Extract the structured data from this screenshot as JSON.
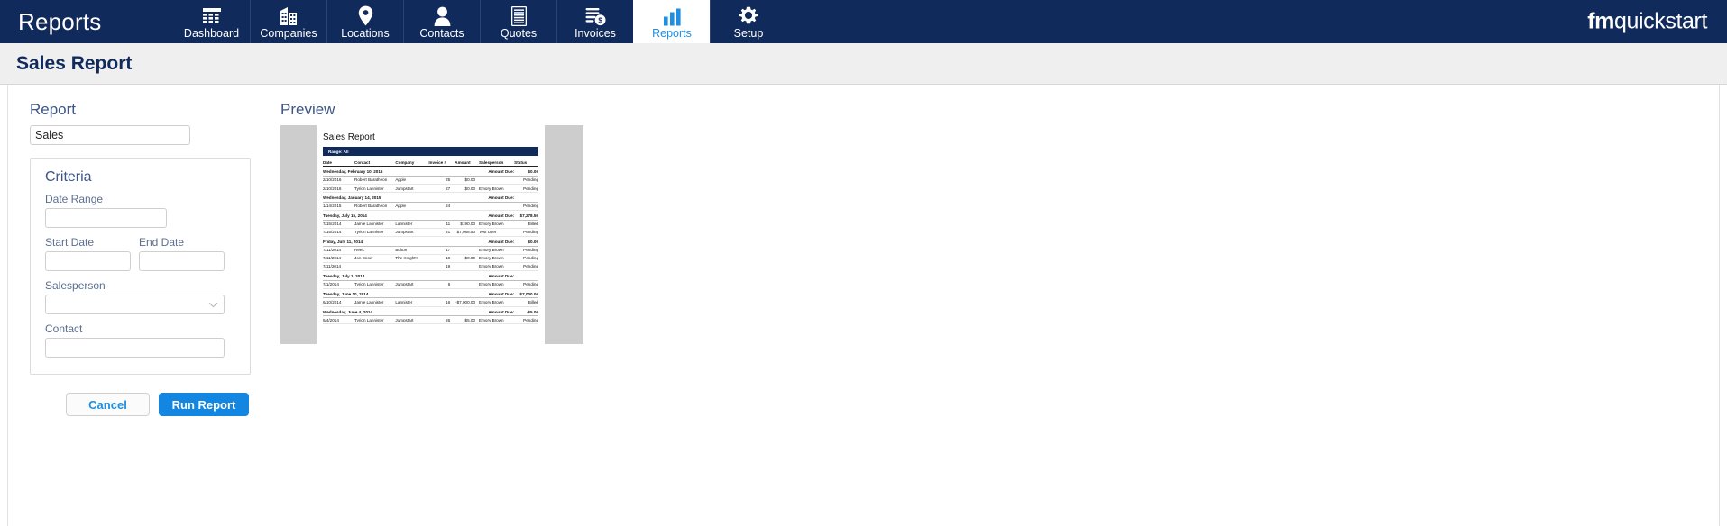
{
  "nav": {
    "title": "Reports",
    "items": [
      {
        "label": "Dashboard",
        "icon": "dashboard-icon",
        "active": false
      },
      {
        "label": "Companies",
        "icon": "building-icon",
        "active": false
      },
      {
        "label": "Locations",
        "icon": "map-pin-icon",
        "active": false
      },
      {
        "label": "Contacts",
        "icon": "person-icon",
        "active": false
      },
      {
        "label": "Quotes",
        "icon": "document-list-icon",
        "active": false
      },
      {
        "label": "Invoices",
        "icon": "invoice-dollar-icon",
        "active": false
      },
      {
        "label": "Reports",
        "icon": "bar-chart-icon",
        "active": true
      },
      {
        "label": "Setup",
        "icon": "gear-icon",
        "active": false
      }
    ],
    "brand_bold": "fm",
    "brand_rest": "quickstart"
  },
  "page": {
    "title": "Sales Report"
  },
  "form": {
    "report_label": "Report",
    "report_name": "Sales",
    "criteria_title": "Criteria",
    "date_range_label": "Date Range",
    "date_range_value": "",
    "date_range_placeholder": "",
    "start_date_label": "Start Date",
    "start_date_value": "",
    "end_date_label": "End Date",
    "end_date_value": "",
    "salesperson_label": "Salesperson",
    "salesperson_value": "",
    "contact_label": "Contact",
    "contact_value": "",
    "cancel_label": "Cancel",
    "run_label": "Run Report"
  },
  "preview": {
    "label": "Preview",
    "report_title": "Sales Report",
    "range_banner": "Range: All",
    "columns": [
      "Date",
      "Contact",
      "Company",
      "Invoice #",
      "Amount",
      "Salesperson",
      "Status"
    ],
    "amount_due_label": "Amount Due:",
    "groups": [
      {
        "heading": "Wednesday, February 10, 2016",
        "amount_due": "$0.00",
        "rows": [
          {
            "date": "2/10/2016",
            "contact": "Robert Baratheon",
            "company": "Apple",
            "invoice": "25",
            "amount": "$0.00",
            "salesperson": "",
            "status": "Pending"
          },
          {
            "date": "2/10/2016",
            "contact": "Tyrion Lannister",
            "company": "Jumpstart",
            "invoice": "27",
            "amount": "$0.00",
            "salesperson": "Emory Brown",
            "status": "Pending"
          }
        ]
      },
      {
        "heading": "Wednesday, January 14, 2015",
        "amount_due": "",
        "rows": [
          {
            "date": "1/14/2015",
            "contact": "Robert Baratheon",
            "company": "Apple",
            "invoice": "24",
            "amount": "",
            "salesperson": "",
            "status": "Pending"
          }
        ]
      },
      {
        "heading": "Tuesday, July 15, 2014",
        "amount_due": "$7,278.50",
        "rows": [
          {
            "date": "7/15/2014",
            "contact": "Jamie Lannister",
            "company": "Lannister",
            "invoice": "11",
            "amount": "$190.00",
            "salesperson": "Emory Brown",
            "status": "Billed"
          },
          {
            "date": "7/15/2014",
            "contact": "Tyrion Lannister",
            "company": "Jumpstart",
            "invoice": "21",
            "amount": "$7,088.50",
            "salesperson": "Test User",
            "status": "Pending"
          }
        ]
      },
      {
        "heading": "Friday, July 11, 2014",
        "amount_due": "$0.00",
        "rows": [
          {
            "date": "7/11/2014",
            "contact": "Reek",
            "company": "Bolton",
            "invoice": "17",
            "amount": "",
            "salesperson": "Emory Brown",
            "status": "Pending"
          },
          {
            "date": "7/11/2014",
            "contact": "Jon Snow",
            "company": "The Knight's",
            "invoice": "18",
            "amount": "$0.00",
            "salesperson": "Emory Brown",
            "status": "Pending"
          },
          {
            "date": "7/11/2014",
            "contact": "",
            "company": "",
            "invoice": "19",
            "amount": "",
            "salesperson": "Emory Brown",
            "status": "Pending"
          }
        ]
      },
      {
        "heading": "Tuesday, July 1, 2014",
        "amount_due": "",
        "rows": [
          {
            "date": "7/1/2014",
            "contact": "Tyrion Lannister",
            "company": "Jumpstart",
            "invoice": "6",
            "amount": "",
            "salesperson": "Emory Brown",
            "status": "Pending"
          }
        ]
      },
      {
        "heading": "Tuesday, June 10, 2014",
        "amount_due": "-$7,000.00",
        "rows": [
          {
            "date": "6/10/2014",
            "contact": "Jamie Lannister",
            "company": "Lannister",
            "invoice": "16",
            "amount": "-$7,000.00",
            "salesperson": "Emory Brown",
            "status": "Billed"
          }
        ]
      },
      {
        "heading": "Wednesday, June 4, 2014",
        "amount_due": "-$5.00",
        "rows": [
          {
            "date": "6/4/2014",
            "contact": "Tyrion Lannister",
            "company": "Jumpstart",
            "invoice": "26",
            "amount": "-$5.00",
            "salesperson": "Emory Brown",
            "status": "Pending"
          }
        ]
      }
    ]
  },
  "colors": {
    "navy": "#112a5c",
    "accent_blue": "#1286e0",
    "link_blue": "#1e8fe3",
    "header_band": "#efefef"
  }
}
